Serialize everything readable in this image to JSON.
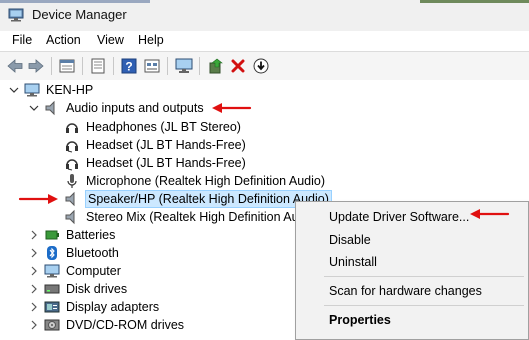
{
  "window": {
    "title": "Device Manager"
  },
  "menu": [
    "File",
    "Action",
    "View",
    "Help"
  ],
  "toolbar": {
    "buttons": [
      "back-icon",
      "forward-icon",
      "properties-icon",
      "update-icon",
      "help-icon",
      "view-icon",
      "monitor-icon",
      "add-driver-icon",
      "uninstall-icon",
      "disable-icon"
    ]
  },
  "tree": {
    "root": "KEN-HP",
    "audio_category": "Audio inputs and outputs",
    "audio_devices": [
      "Headphones (JL BT Stereo)",
      "Headset (JL BT Hands-Free)",
      "Headset (JL BT Hands-Free)",
      "Microphone (Realtek High Definition Audio)",
      "Speaker/HP (Realtek High Definition Audio)",
      "Stereo Mix (Realtek High Definition Audi"
    ],
    "categories": [
      "Batteries",
      "Bluetooth",
      "Computer",
      "Disk drives",
      "Display adapters",
      "DVD/CD-ROM drives"
    ]
  },
  "context_menu": {
    "update": "Update Driver Software...",
    "disable": "Disable",
    "uninstall": "Uninstall",
    "scan": "Scan for hardware changes",
    "properties": "Properties"
  },
  "colors": {
    "annotation_arrow": "#e01010",
    "selection_bg": "#cce8ff",
    "uninstall_red": "#d21010"
  }
}
